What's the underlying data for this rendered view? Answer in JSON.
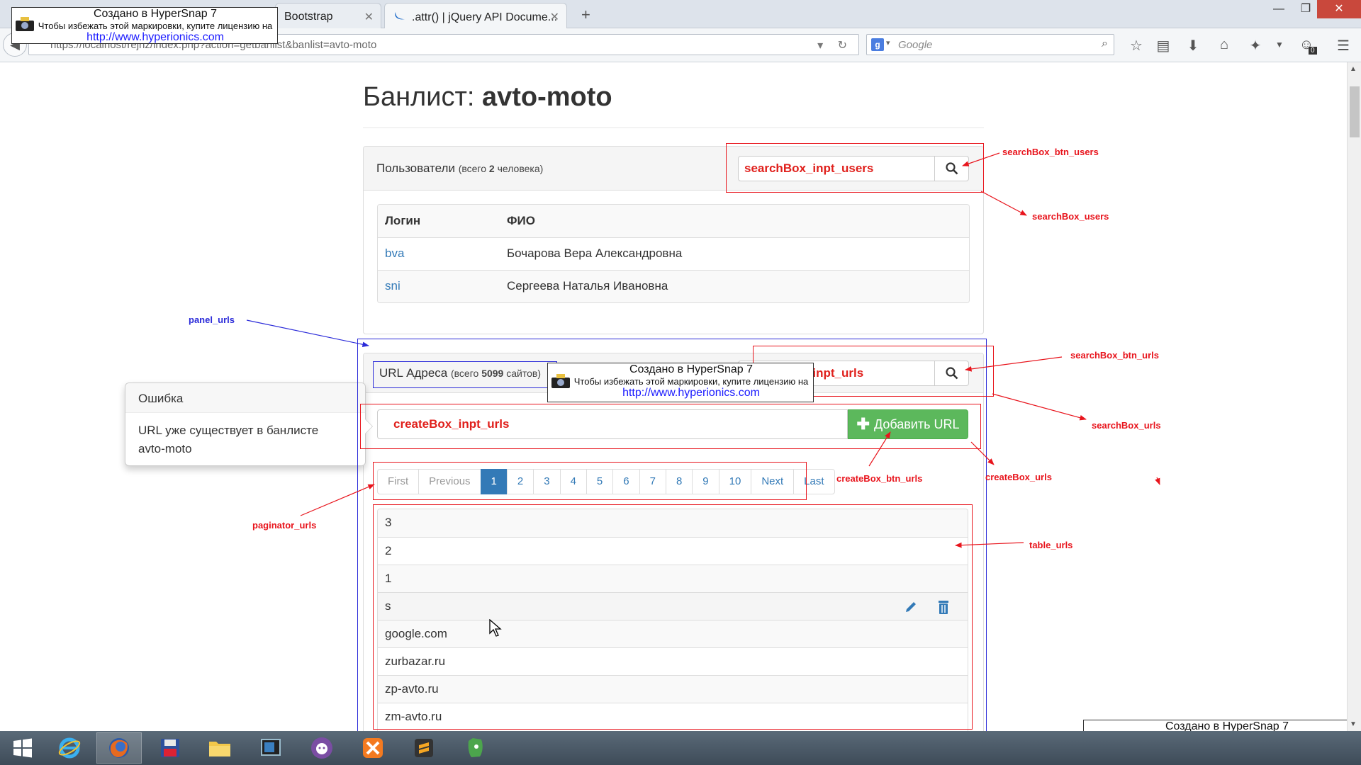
{
  "browser": {
    "tabs": [
      {
        "label": "Bootstrap"
      },
      {
        "label": ".attr() | jQuery API Docume..."
      }
    ],
    "url": "https://localhost/rejhz/index.php?action=getbanlist&banlist=avto-moto",
    "search_placeholder": "Google",
    "notification_count": "0"
  },
  "page": {
    "title_prefix": "Банлист:",
    "title_name": "avto-moto"
  },
  "users_panel": {
    "caption": "Пользователи",
    "count_prefix": "(всего",
    "count": "2",
    "count_suffix": "человека)",
    "search_text": "searchBox_inpt_users",
    "columns": [
      "Логин",
      "ФИО"
    ],
    "rows": [
      {
        "login": "bva",
        "name": "Бочарова Вера Александровна"
      },
      {
        "login": "sni",
        "name": "Сергеева Наталья Ивановна"
      }
    ]
  },
  "urls_panel": {
    "caption": "URL Адреса",
    "count_prefix": "(всего",
    "count": "5099",
    "count_suffix": "сайтов)",
    "search_text": "searchBox_inpt_urls",
    "create_text": "createBox_inpt_urls",
    "add_button": "Добавить URL",
    "pager": [
      "First",
      "Previous",
      "1",
      "2",
      "3",
      "4",
      "5",
      "6",
      "7",
      "8",
      "9",
      "10",
      "Next",
      "Last"
    ],
    "pager_active": "1",
    "rows": [
      "3",
      "2",
      "1",
      "s",
      "google.com",
      "zurbazar.ru",
      "zp-avto.ru",
      "zm-avto.ru"
    ]
  },
  "popover": {
    "title": "Ошибка",
    "line1": "URL уже существует в банлисте",
    "line2": "avto-moto"
  },
  "annotations": {
    "searchBox_btn_users": "searchBox_btn_users",
    "searchBox_users": "searchBox_users",
    "panel_urls": "panel_urls",
    "searchBox_btn_urls": "searchBox_btn_urls",
    "searchBox_urls": "searchBox_urls",
    "createBox_btn_urls": "createBox_btn_urls",
    "createBox_urls": "createBox_urls",
    "paginator_urls": "paginator_urls",
    "table_urls": "table_urls"
  },
  "watermark": {
    "line1": "Создано в HyperSnap 7",
    "line2": "Чтобы избежать этой маркировки, купите лицензию на",
    "link": "http://www.hyperionics.com"
  },
  "colors": {
    "annotation_red": "#e8141c",
    "annotation_blue": "#2b2bd9",
    "primary": "#337ab7",
    "success": "#5cb85c"
  },
  "icons": [
    "search-icon",
    "pencil-icon",
    "trash-icon",
    "plus-icon",
    "camera-icon",
    "mouse-cursor-icon"
  ]
}
